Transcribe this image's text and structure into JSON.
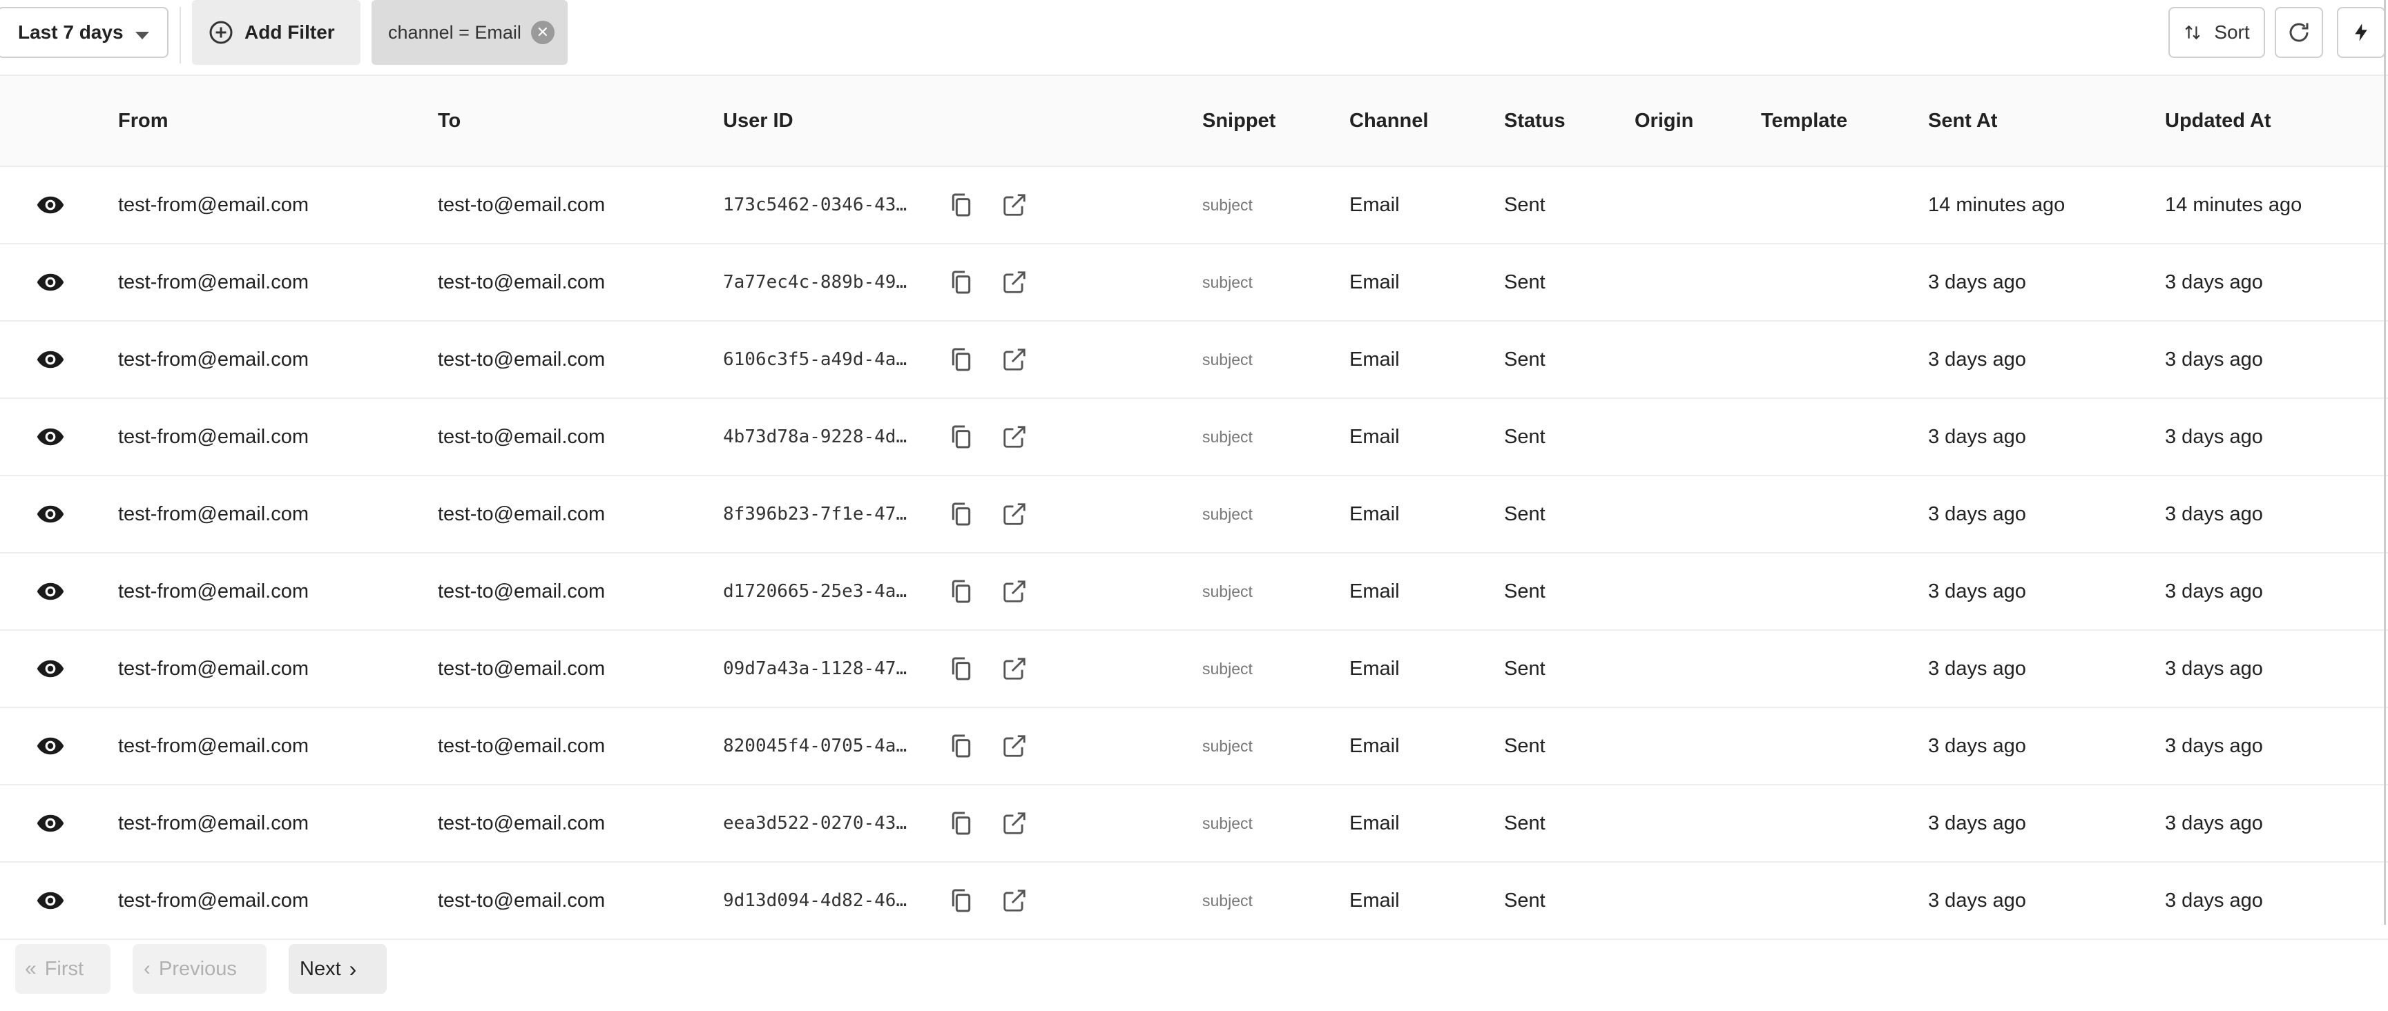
{
  "toolbar": {
    "date_range": "Last 7 days",
    "add_filter": "Add Filter",
    "filter_chip": "channel = Email",
    "sort": "Sort"
  },
  "columns": [
    "From",
    "To",
    "User ID",
    "Snippet",
    "Channel",
    "Status",
    "Origin",
    "Template",
    "Sent At",
    "Updated At"
  ],
  "rows": [
    {
      "from": "test-from@email.com",
      "to": "test-to@email.com",
      "user_id": "173c5462-0346-43…",
      "snippet": "subject",
      "channel": "Email",
      "status": "Sent",
      "origin": "",
      "template": "",
      "sent_at": "14 minutes ago",
      "updated_at": "14 minutes ago"
    },
    {
      "from": "test-from@email.com",
      "to": "test-to@email.com",
      "user_id": "7a77ec4c-889b-49…",
      "snippet": "subject",
      "channel": "Email",
      "status": "Sent",
      "origin": "",
      "template": "",
      "sent_at": "3 days ago",
      "updated_at": "3 days ago"
    },
    {
      "from": "test-from@email.com",
      "to": "test-to@email.com",
      "user_id": "6106c3f5-a49d-4a…",
      "snippet": "subject",
      "channel": "Email",
      "status": "Sent",
      "origin": "",
      "template": "",
      "sent_at": "3 days ago",
      "updated_at": "3 days ago"
    },
    {
      "from": "test-from@email.com",
      "to": "test-to@email.com",
      "user_id": "4b73d78a-9228-4d…",
      "snippet": "subject",
      "channel": "Email",
      "status": "Sent",
      "origin": "",
      "template": "",
      "sent_at": "3 days ago",
      "updated_at": "3 days ago"
    },
    {
      "from": "test-from@email.com",
      "to": "test-to@email.com",
      "user_id": "8f396b23-7f1e-47…",
      "snippet": "subject",
      "channel": "Email",
      "status": "Sent",
      "origin": "",
      "template": "",
      "sent_at": "3 days ago",
      "updated_at": "3 days ago"
    },
    {
      "from": "test-from@email.com",
      "to": "test-to@email.com",
      "user_id": "d1720665-25e3-4a…",
      "snippet": "subject",
      "channel": "Email",
      "status": "Sent",
      "origin": "",
      "template": "",
      "sent_at": "3 days ago",
      "updated_at": "3 days ago"
    },
    {
      "from": "test-from@email.com",
      "to": "test-to@email.com",
      "user_id": "09d7a43a-1128-47…",
      "snippet": "subject",
      "channel": "Email",
      "status": "Sent",
      "origin": "",
      "template": "",
      "sent_at": "3 days ago",
      "updated_at": "3 days ago"
    },
    {
      "from": "test-from@email.com",
      "to": "test-to@email.com",
      "user_id": "820045f4-0705-4a…",
      "snippet": "subject",
      "channel": "Email",
      "status": "Sent",
      "origin": "",
      "template": "",
      "sent_at": "3 days ago",
      "updated_at": "3 days ago"
    },
    {
      "from": "test-from@email.com",
      "to": "test-to@email.com",
      "user_id": "eea3d522-0270-43…",
      "snippet": "subject",
      "channel": "Email",
      "status": "Sent",
      "origin": "",
      "template": "",
      "sent_at": "3 days ago",
      "updated_at": "3 days ago"
    },
    {
      "from": "test-from@email.com",
      "to": "test-to@email.com",
      "user_id": "9d13d094-4d82-46…",
      "snippet": "subject",
      "channel": "Email",
      "status": "Sent",
      "origin": "",
      "template": "",
      "sent_at": "3 days ago",
      "updated_at": "3 days ago"
    }
  ],
  "pagination": {
    "first": "First",
    "previous": "Previous",
    "next": "Next"
  },
  "icons": {
    "row_view": "eye-icon",
    "copy": "copy-icon",
    "open": "open-external-icon",
    "refresh": "refresh-icon",
    "actions": "lightning-bolt-icon"
  }
}
